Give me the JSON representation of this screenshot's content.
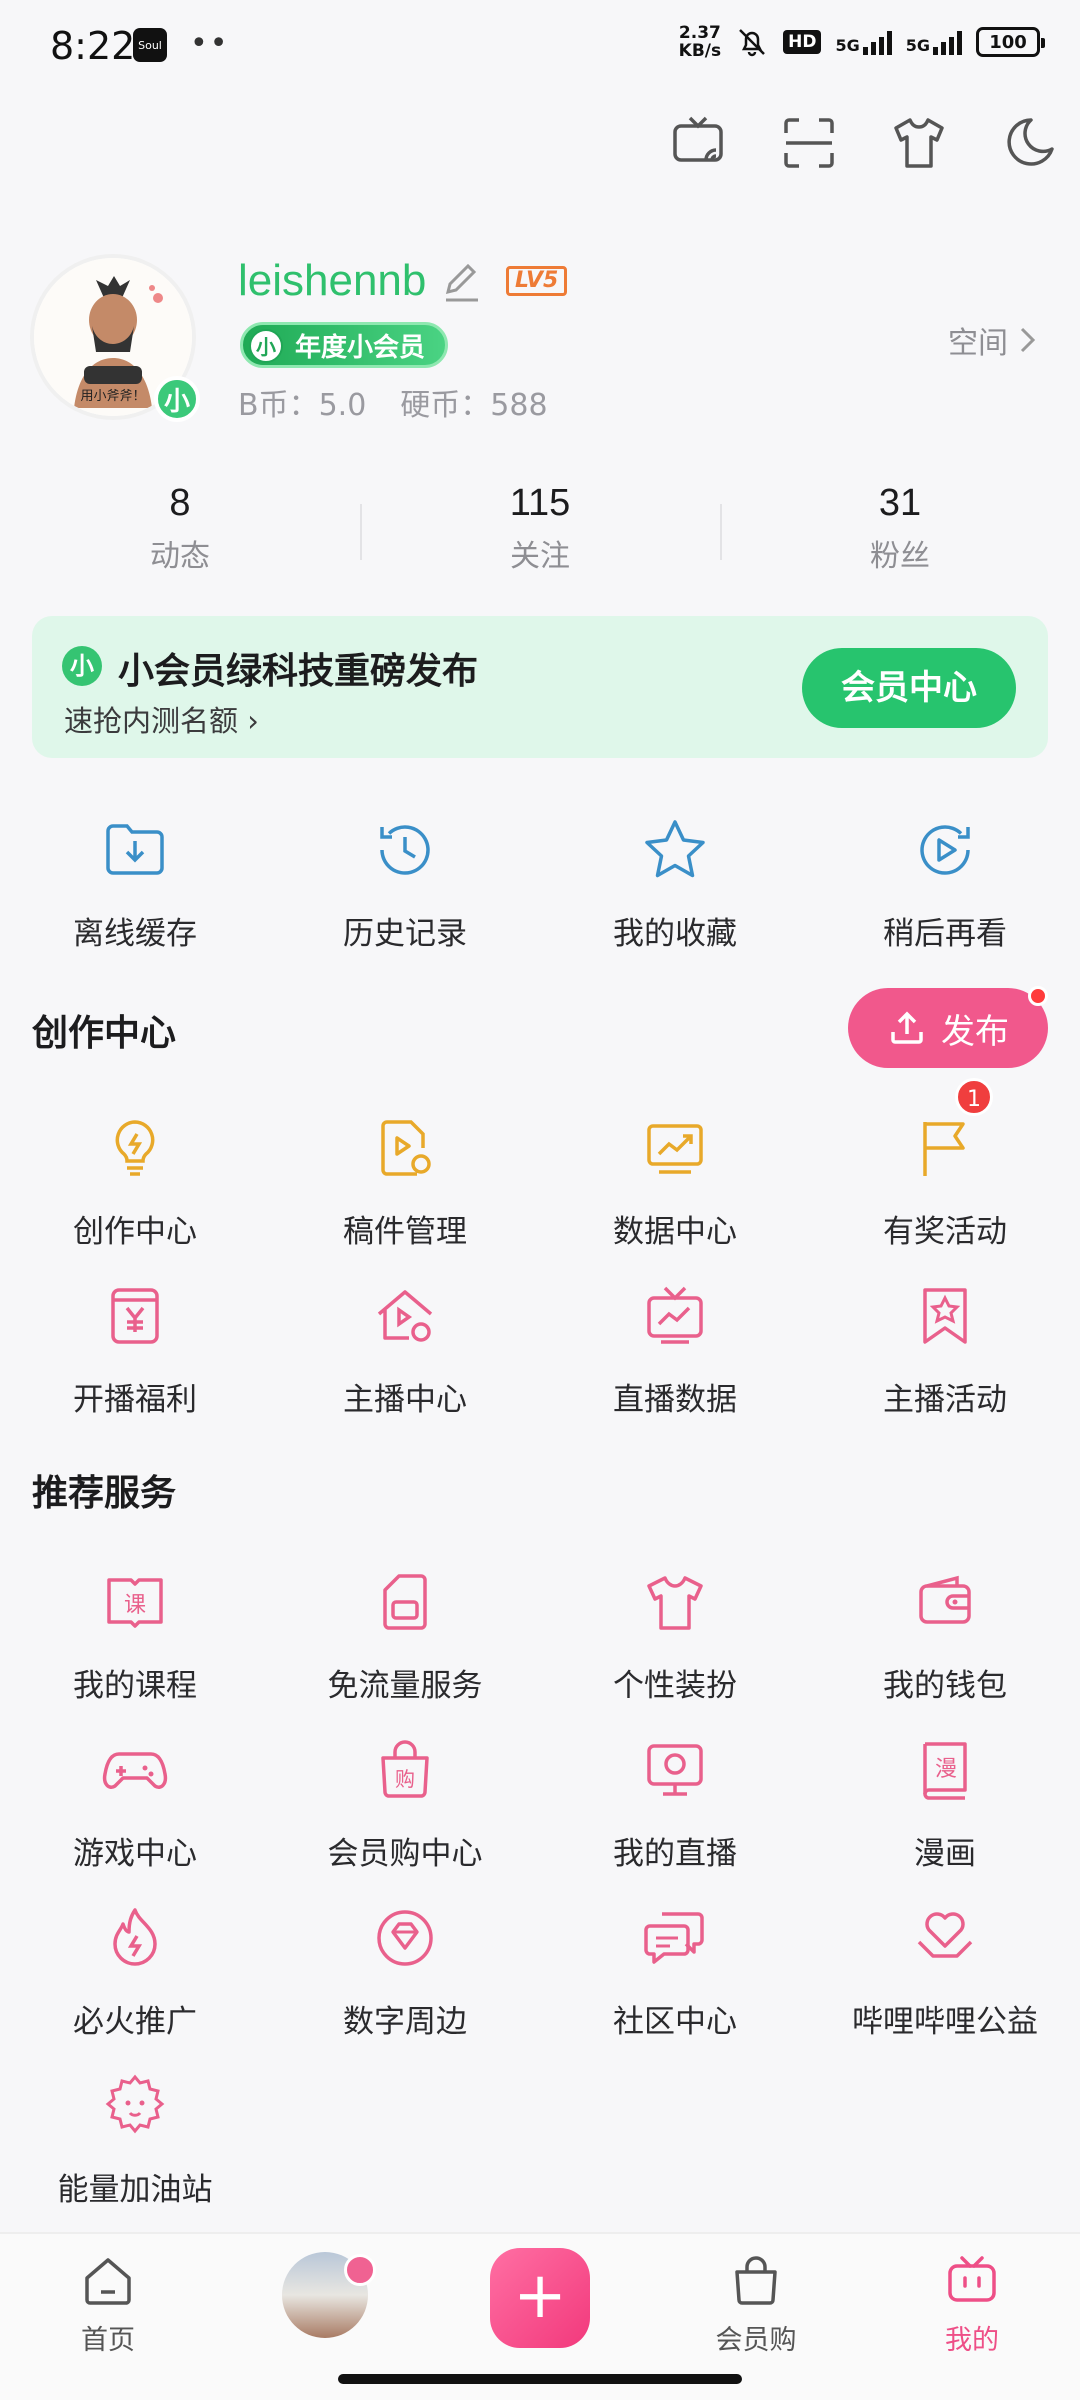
{
  "status_bar": {
    "time": "8:22",
    "soul_label": "Soul",
    "dots": "••",
    "net_speed": "2.37",
    "net_unit": "KB/s",
    "hd": "HD",
    "signal_1": "5G",
    "signal_2": "5G",
    "battery": "100"
  },
  "profile": {
    "username": "leishennb",
    "level": "LV5",
    "vip_label": "年度小会员",
    "vip_icon": "小",
    "avatar_badge": "小",
    "b_coin": "B币：5.0",
    "hard_coin": "硬币：588",
    "space_label": "空间"
  },
  "stats": [
    {
      "value": "8",
      "label": "动态"
    },
    {
      "value": "115",
      "label": "关注"
    },
    {
      "value": "31",
      "label": "粉丝"
    }
  ],
  "banner": {
    "icon": "小",
    "title": "小会员绿科技重磅发布",
    "subtitle": "速抢内测名额",
    "button": "会员中心"
  },
  "quick_actions": [
    {
      "label": "离线缓存",
      "icon": "offline-cache-icon"
    },
    {
      "label": "历史记录",
      "icon": "history-icon"
    },
    {
      "label": "我的收藏",
      "icon": "favorites-star-icon"
    },
    {
      "label": "稍后再看",
      "icon": "watch-later-icon"
    }
  ],
  "creation": {
    "title": "创作中心",
    "publish_label": "发布",
    "items": [
      {
        "label": "创作中心",
        "icon": "bulb-icon"
      },
      {
        "label": "稿件管理",
        "icon": "manuscript-icon"
      },
      {
        "label": "数据中心",
        "icon": "data-chart-icon"
      },
      {
        "label": "有奖活动",
        "icon": "flag-icon",
        "badge": "1"
      },
      {
        "label": "开播福利",
        "icon": "yen-gift-icon"
      },
      {
        "label": "主播中心",
        "icon": "streamer-home-icon"
      },
      {
        "label": "直播数据",
        "icon": "tv-chart-icon"
      },
      {
        "label": "主播活动",
        "icon": "star-bookmark-icon"
      }
    ]
  },
  "services": {
    "title": "推荐服务",
    "items": [
      {
        "label": "我的课程",
        "icon": "course-book-icon",
        "glyph": "课"
      },
      {
        "label": "免流量服务",
        "icon": "sim-card-icon"
      },
      {
        "label": "个性装扮",
        "icon": "shirt-icon"
      },
      {
        "label": "我的钱包",
        "icon": "wallet-icon"
      },
      {
        "label": "游戏中心",
        "icon": "gamepad-icon"
      },
      {
        "label": "会员购中心",
        "icon": "shopping-bag-icon",
        "glyph": "购"
      },
      {
        "label": "我的直播",
        "icon": "live-monitor-icon"
      },
      {
        "label": "漫画",
        "icon": "comic-book-icon",
        "glyph": "漫"
      },
      {
        "label": "必火推广",
        "icon": "flame-icon"
      },
      {
        "label": "数字周边",
        "icon": "diamond-icon"
      },
      {
        "label": "社区中心",
        "icon": "chat-bubbles-icon"
      },
      {
        "label": "哔哩哔哩公益",
        "icon": "heart-hands-icon"
      },
      {
        "label": "能量加油站",
        "icon": "energy-cat-icon"
      }
    ]
  },
  "bottom_nav": [
    {
      "label": "首页",
      "icon": "home-icon"
    },
    {
      "label": "",
      "icon": "dynamic-avatar-icon"
    },
    {
      "label": "+",
      "icon": "plus-icon"
    },
    {
      "label": "会员购",
      "icon": "shopping-bag-icon"
    },
    {
      "label": "我的",
      "icon": "tv-mine-icon",
      "active": true
    }
  ],
  "colors": {
    "accent_pink": "#F1588C",
    "vip_green": "#27C46E",
    "icon_blue": "#3A8FC8",
    "icon_yellow": "#E8A92A",
    "banner_bg": "#DFF7EA"
  }
}
